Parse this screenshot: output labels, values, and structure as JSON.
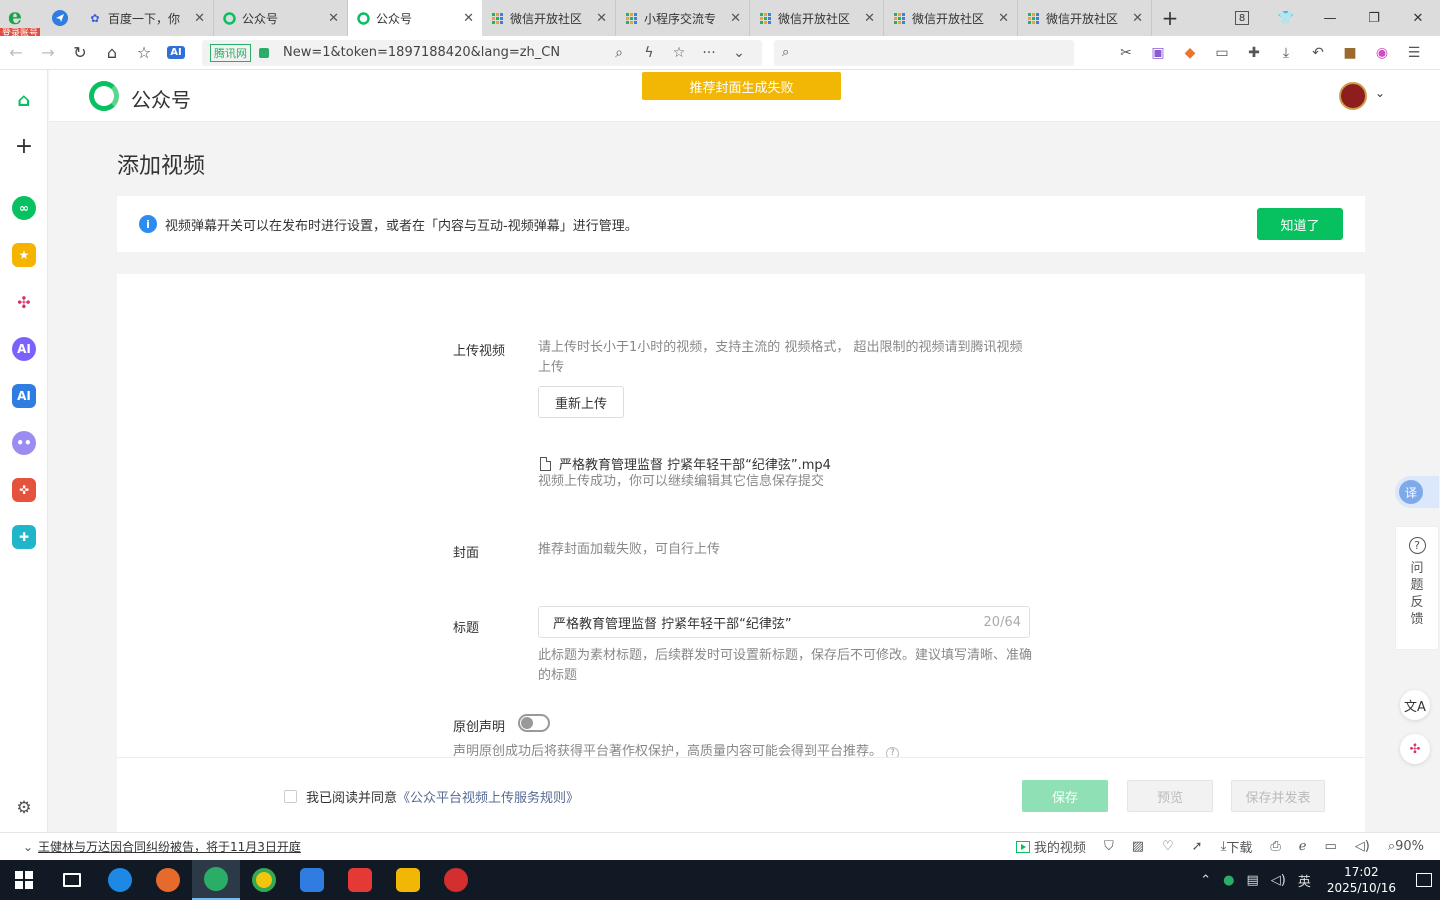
{
  "browser": {
    "login_badge": "登录账号",
    "tabs": [
      {
        "label": "百度一下，你",
        "icon": "baidu-paw-icon",
        "active": false
      },
      {
        "label": "公众号",
        "icon": "wechat-mp-icon",
        "active": false
      },
      {
        "label": "公众号",
        "icon": "wechat-mp-icon",
        "active": true
      },
      {
        "label": "微信开放社区",
        "icon": "dots-grid-icon",
        "active": false
      },
      {
        "label": "小程序交流专",
        "icon": "dots-grid-icon",
        "active": false
      },
      {
        "label": "微信开放社区",
        "icon": "dots-grid-icon",
        "active": false
      },
      {
        "label": "微信开放社区",
        "icon": "dots-grid-icon",
        "active": false
      },
      {
        "label": "微信开放社区",
        "icon": "dots-grid-icon",
        "active": false
      }
    ],
    "tab_count": "8",
    "ai_label": "AI",
    "site_tag": "腾讯网",
    "url": "New=1&token=1897188420&lang=zh_CN",
    "search_placeholder": ""
  },
  "header": {
    "title": "公众号",
    "banner": "推荐封面生成失败"
  },
  "page": {
    "title": "添加视频",
    "notice": {
      "text": "视频弹幕开关可以在发布时进行设置，或者在「内容与互动-视频弹幕」进行管理。",
      "button": "知道了"
    },
    "form": {
      "upload_label": "上传视频",
      "upload_hint": "请上传时长小于1小时的视频，支持主流的 视频格式， 超出限制的视频请到腾讯视频上传",
      "reupload_button": "重新上传",
      "file_name": "严格教育管理监督 拧紧年轻干部“纪律弦”.mp4",
      "file_status": "视频上传成功，你可以继续编辑其它信息保存提交",
      "cover_label": "封面",
      "cover_hint": "推荐封面加载失败，可自行上传",
      "title_label": "标题",
      "title_value": "严格教育管理监督 拧紧年轻干部“纪律弦”",
      "title_count": "20/64",
      "title_hint": "此标题为素材标题，后续群发时可设置新标题，保存后不可修改。建议填写清晰、准确的标题",
      "original_label": "原创声明",
      "original_enabled": false,
      "original_hint": "声明原创成功后将获得平台著作权保护，高质量内容可能会得到平台推荐。"
    },
    "footer": {
      "agree_prefix": "我已阅读并同意",
      "agree_link": "《公众平台视频上传服务规则》",
      "save": "保存",
      "preview": "预览",
      "save_publish": "保存并发表"
    },
    "float": {
      "translate": "译",
      "feedback": "问题反馈"
    }
  },
  "statusbar": {
    "news": "王健林与万达因合同纠纷被告，将于11月3日开庭",
    "my_video": "我的视频",
    "download": "下载",
    "zoom": "90%"
  },
  "taskbar": {
    "ime": "英",
    "time": "17:02",
    "date": "2025/10/16"
  },
  "colors": {
    "brand_green": "#07c160",
    "banner_yellow": "#f2b705",
    "link_blue": "#576b95",
    "info_blue": "#2d8cf0"
  }
}
